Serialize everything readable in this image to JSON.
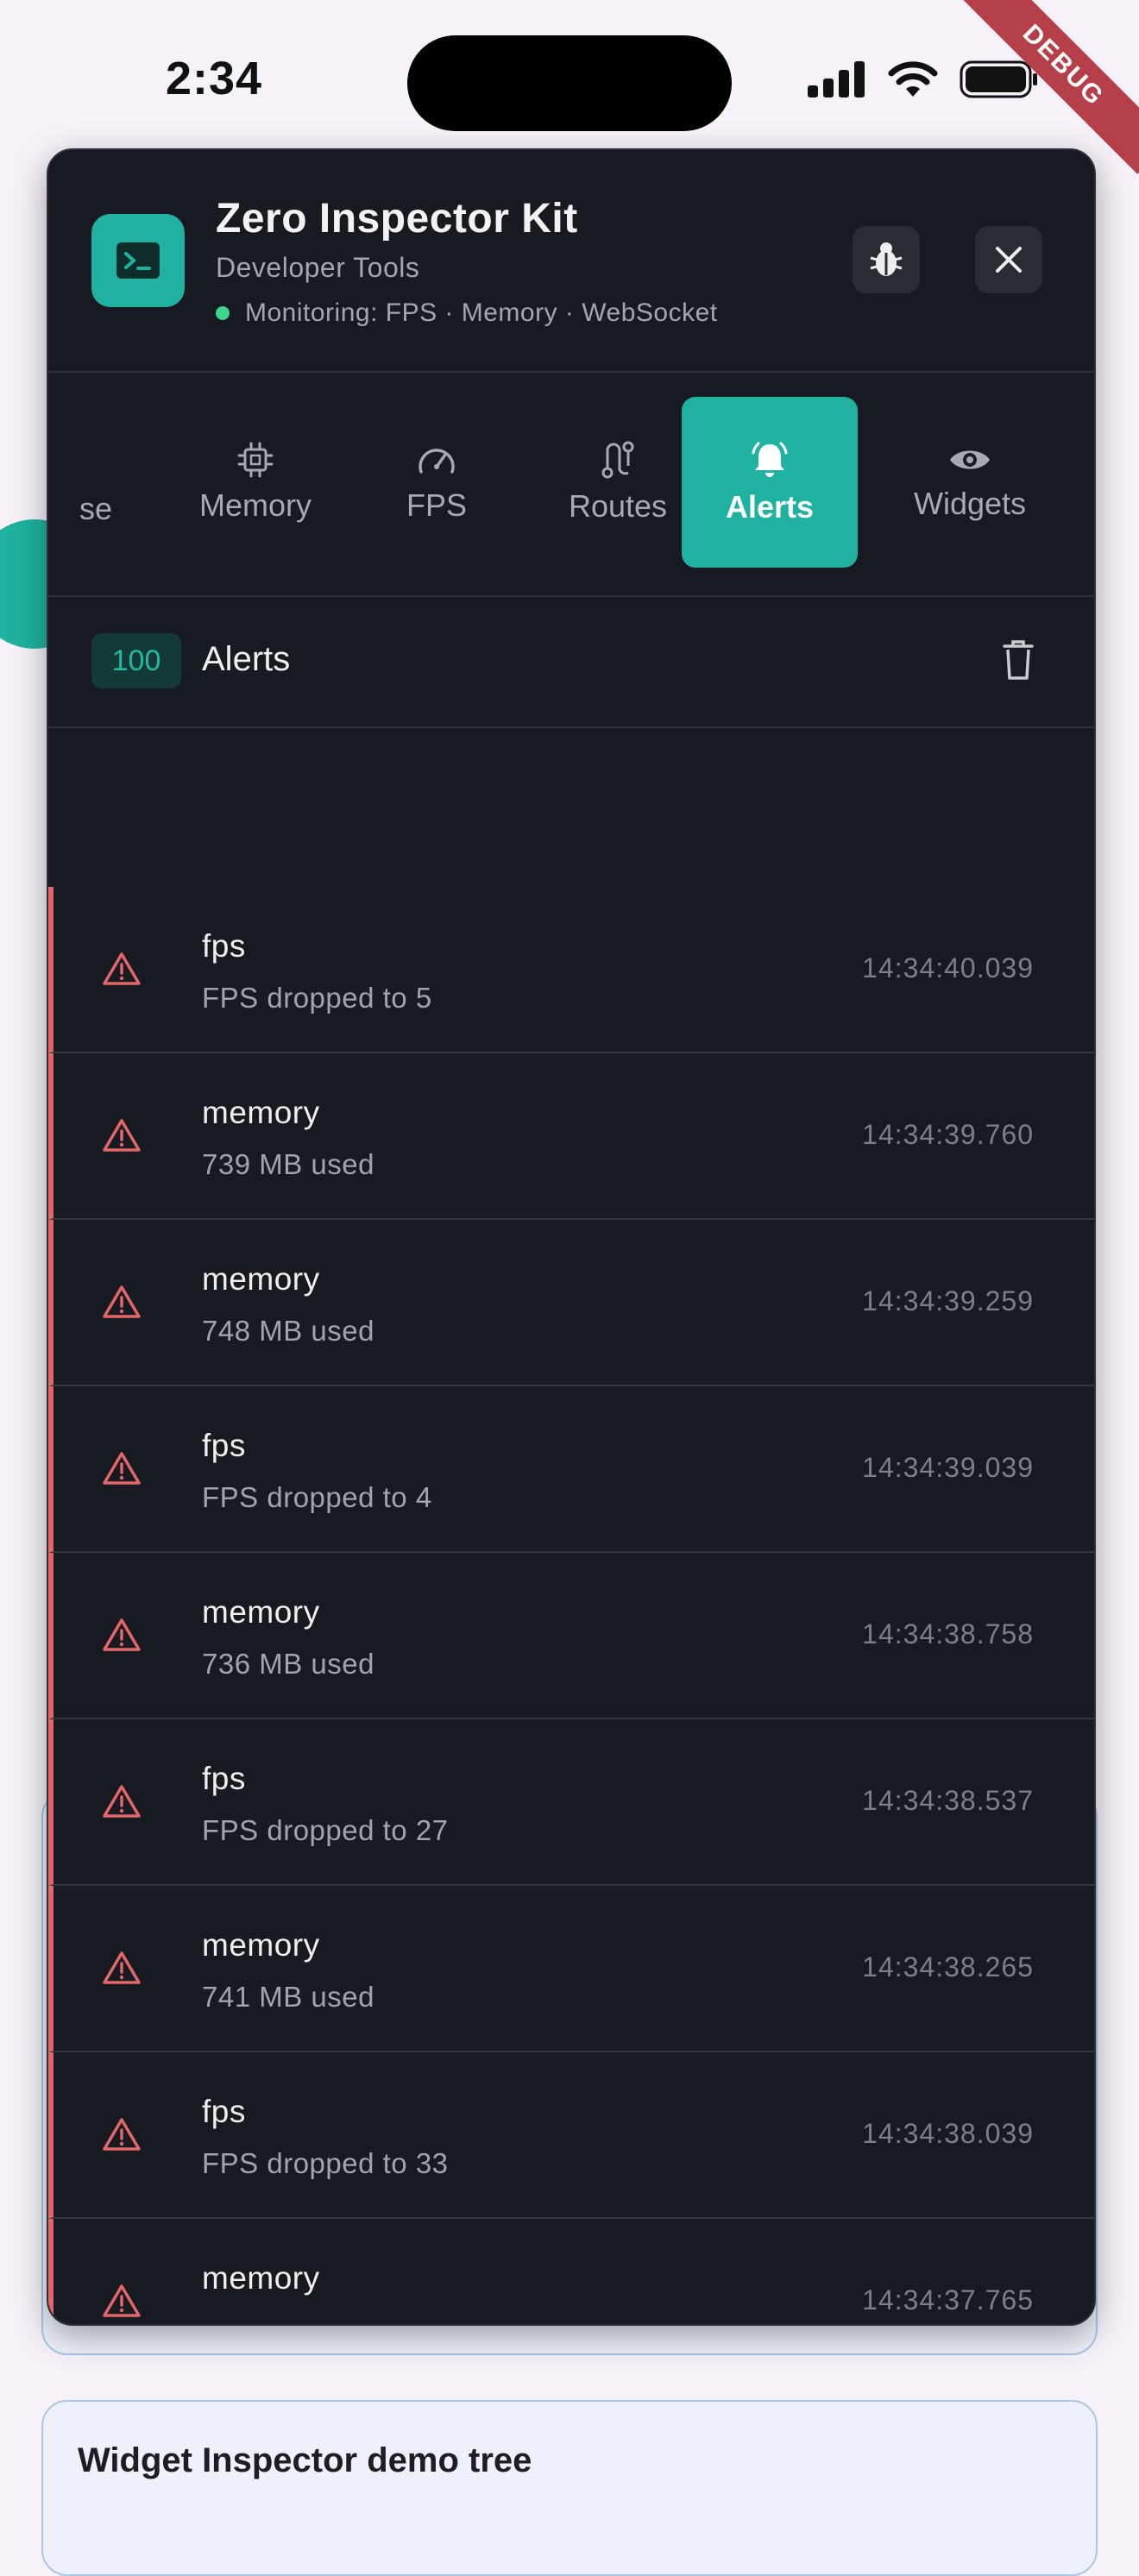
{
  "status_bar": {
    "time": "2:34",
    "debug_label": "DEBUG"
  },
  "background": {
    "card_title": "Widget Inspector demo tree"
  },
  "header": {
    "title": "Zero Inspector Kit",
    "subtitle": "Developer Tools",
    "monitoring": "Monitoring: FPS · Memory · WebSocket"
  },
  "tabs": {
    "partial": "se",
    "items": [
      {
        "label": "Memory",
        "icon": "chip-icon"
      },
      {
        "label": "FPS",
        "icon": "gauge-icon"
      },
      {
        "label": "Routes",
        "icon": "route-icon"
      },
      {
        "label": "Alerts",
        "icon": "bell-icon",
        "active": true
      },
      {
        "label": "Widgets",
        "icon": "eye-icon"
      }
    ]
  },
  "alerts_bar": {
    "count": "100",
    "title": "Alerts"
  },
  "alerts": [
    {
      "type": "fps",
      "message": "FPS dropped to 5",
      "time": "14:34:40.039"
    },
    {
      "type": "memory",
      "message": "739 MB used",
      "time": "14:34:39.760"
    },
    {
      "type": "memory",
      "message": "748 MB used",
      "time": "14:34:39.259"
    },
    {
      "type": "fps",
      "message": "FPS dropped to 4",
      "time": "14:34:39.039"
    },
    {
      "type": "memory",
      "message": "736 MB used",
      "time": "14:34:38.758"
    },
    {
      "type": "fps",
      "message": "FPS dropped to 27",
      "time": "14:34:38.537"
    },
    {
      "type": "memory",
      "message": "741 MB used",
      "time": "14:34:38.265"
    },
    {
      "type": "fps",
      "message": "FPS dropped to 33",
      "time": "14:34:38.039"
    },
    {
      "type": "memory",
      "message": "",
      "time": "14:34:37.765"
    }
  ],
  "colors": {
    "accent": "#20b2a0",
    "panel": "#181a22",
    "alert": "#e2666a"
  }
}
